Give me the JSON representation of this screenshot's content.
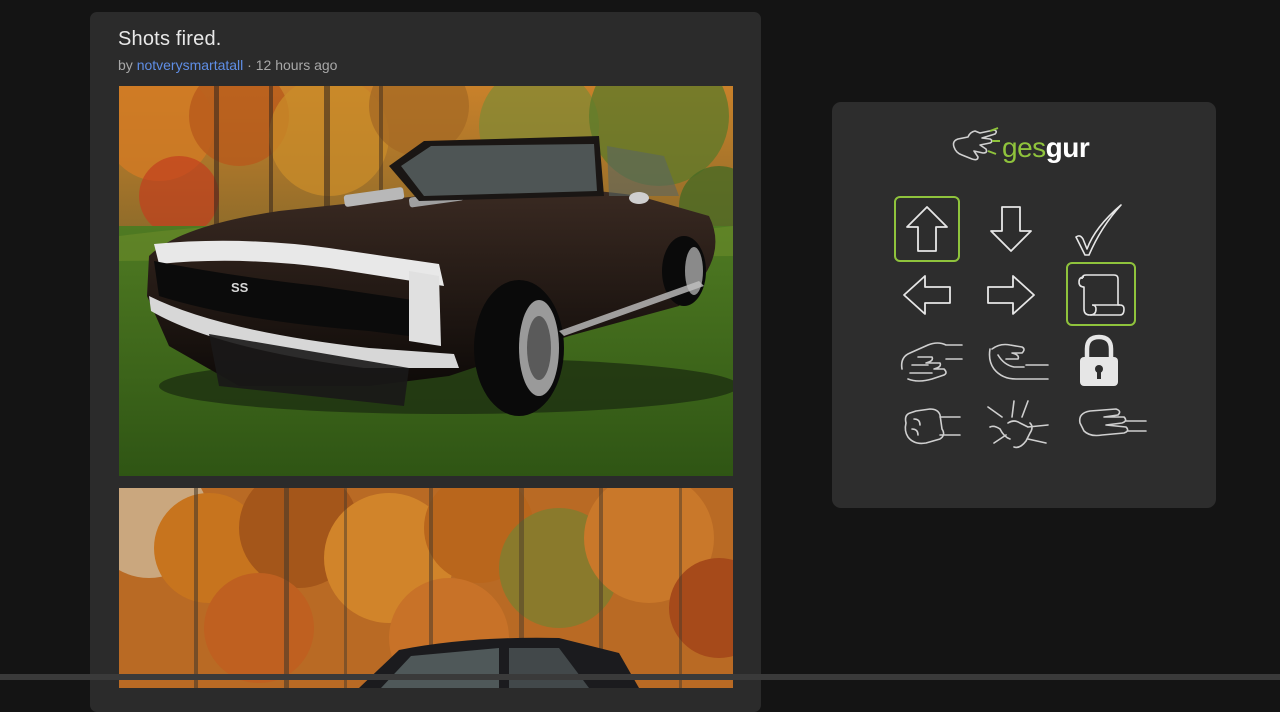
{
  "post": {
    "title": "Shots fired.",
    "by_label": "by",
    "author": "notverysmartatall",
    "separator": "·",
    "time_ago": "12 hours ago",
    "photos": [
      {
        "name": "black-camaro-ss-in-autumn-field"
      },
      {
        "name": "camaro-in-autumn-forest"
      }
    ]
  },
  "sidebar": {
    "logo": {
      "ges": "ges",
      "gur": "gur"
    },
    "accent_color": "#8fc33c",
    "gestures": [
      {
        "name": "arrow-up",
        "selected": true
      },
      {
        "name": "arrow-down",
        "selected": false
      },
      {
        "name": "checkmark",
        "selected": false
      },
      {
        "name": "arrow-left",
        "selected": false
      },
      {
        "name": "arrow-right",
        "selected": false
      },
      {
        "name": "scroll",
        "selected": true
      },
      {
        "name": "hand-palm-down",
        "selected": false
      },
      {
        "name": "hand-palm-up",
        "selected": false
      },
      {
        "name": "lock",
        "selected": false
      },
      {
        "name": "hand-fist",
        "selected": false
      },
      {
        "name": "hand-open",
        "selected": false
      },
      {
        "name": "hand-point",
        "selected": false
      }
    ]
  }
}
